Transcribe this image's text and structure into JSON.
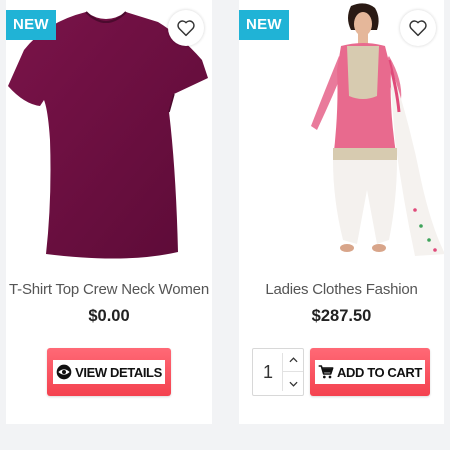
{
  "products": [
    {
      "badge": "NEW",
      "title": "T-Shirt Top Crew Neck Women",
      "price": "$0.00",
      "action_label": "VIEW DETAILS",
      "image": "t-shirt-image",
      "action_icon": "eye-icon"
    },
    {
      "badge": "NEW",
      "title": "Ladies Clothes Fashion",
      "price": "$287.50",
      "action_label": "ADD TO CART",
      "image": "salwar-suit-image",
      "action_icon": "cart-icon",
      "quantity": "1"
    }
  ],
  "colors": {
    "badge": "#20b3d6",
    "button": "#f4424f",
    "tshirt": "#6d0f42",
    "suit": "#e86a8e"
  }
}
